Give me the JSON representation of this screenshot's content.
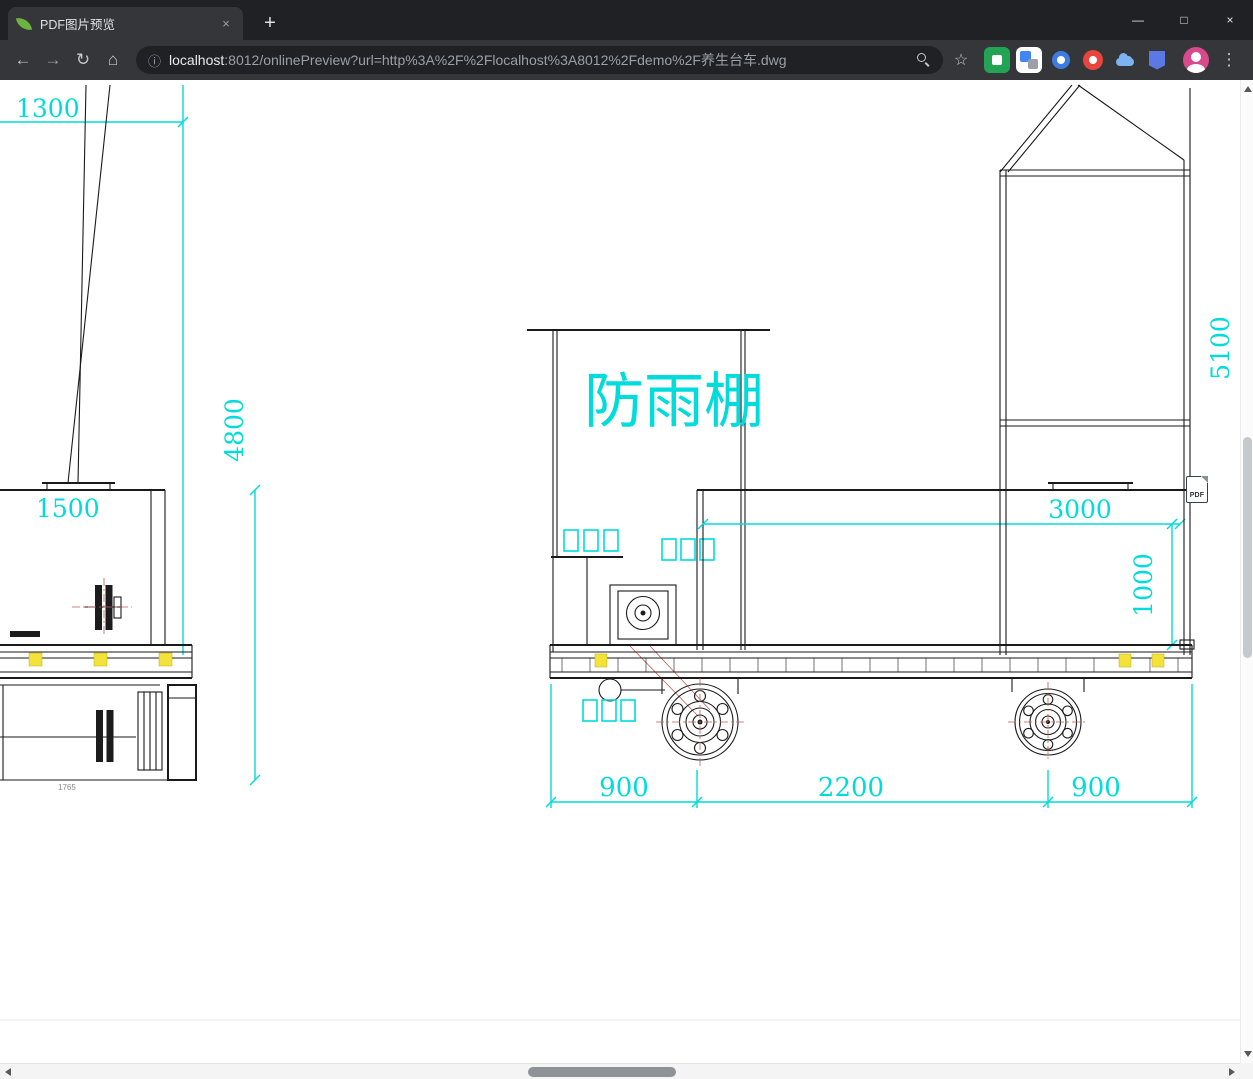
{
  "browser": {
    "tab_title": "PDF图片预览",
    "url": {
      "host": "localhost",
      "path": ":8012/onlinePreview?url=http%3A%2F%2Flocalhost%3A8012%2Fdemo%2F养生台车.dwg"
    },
    "icons": {
      "tab_close": "×",
      "new_tab": "+",
      "minimize": "—",
      "maximize": "□",
      "close": "×",
      "back": "←",
      "forward": "→",
      "reload": "↻",
      "home": "⌂",
      "info": "ⓘ",
      "bookmark_star": "☆",
      "menu": "⋮"
    }
  },
  "drawing": {
    "shelter_label": "防雨棚",
    "pdf_badge": "PDF",
    "dimensions": {
      "top_left_width": "1300",
      "left_height": "4800",
      "left_width": "1500",
      "left_small": "1765",
      "right_height": "5100",
      "platform_width": "3000",
      "platform_height": "1000",
      "wheelbase_left": "900",
      "wheelbase_center": "2200",
      "wheelbase_right": "900"
    }
  },
  "colors": {
    "dimension": "#00dcdc",
    "line": "#1a1a1a",
    "centerline": "#c25b5b",
    "highlight": "#f2e23a"
  }
}
